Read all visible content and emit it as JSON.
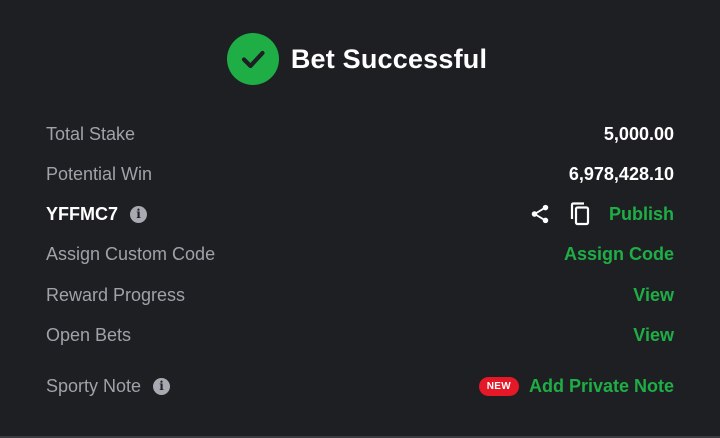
{
  "header": {
    "title": "Bet Successful"
  },
  "rows": {
    "total_stake": {
      "label": "Total Stake",
      "value": "5,000.00"
    },
    "potential_win": {
      "label": "Potential Win",
      "value": "6,978,428.10"
    },
    "booking": {
      "code": "YFFMC7",
      "publish_label": "Publish"
    },
    "custom_code": {
      "label": "Assign Custom Code",
      "action": "Assign Code"
    },
    "reward_progress": {
      "label": "Reward Progress",
      "action": "View"
    },
    "open_bets": {
      "label": "Open Bets",
      "action": "View"
    },
    "sporty_note": {
      "label": "Sporty Note",
      "badge": "NEW",
      "action": "Add Private Note"
    }
  },
  "icons": {
    "success": "check-circle-icon",
    "info": "info-icon",
    "share": "share-icon",
    "copy": "copy-icon"
  },
  "colors": {
    "background": "#1e1f23",
    "accent_green": "#1fae46",
    "label_gray": "#9fa2a9",
    "badge_red": "#e41827"
  }
}
